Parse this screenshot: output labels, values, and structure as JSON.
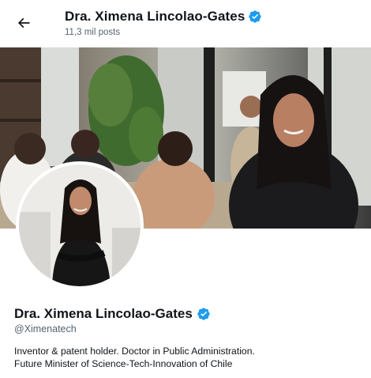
{
  "header": {
    "display_name": "Dra. Ximena Lincolao-Gates",
    "posts_count": "11,3 mil posts",
    "back_icon": "arrow-left-icon",
    "verified_icon": "verified-badge-icon"
  },
  "profile": {
    "display_name": "Dra. Ximena Lincolao-Gates",
    "handle": "@Ximenatech",
    "bio_line1": "Inventor & patent holder. Doctor in Public Administration.",
    "bio_line2": "Future Minister of Science-Tech-Innovation of Chile",
    "verified_icon": "verified-badge-icon"
  },
  "colors": {
    "verified_blue": "#1d9bf0",
    "secondary_text": "#536471",
    "primary_text": "#0f1419"
  }
}
